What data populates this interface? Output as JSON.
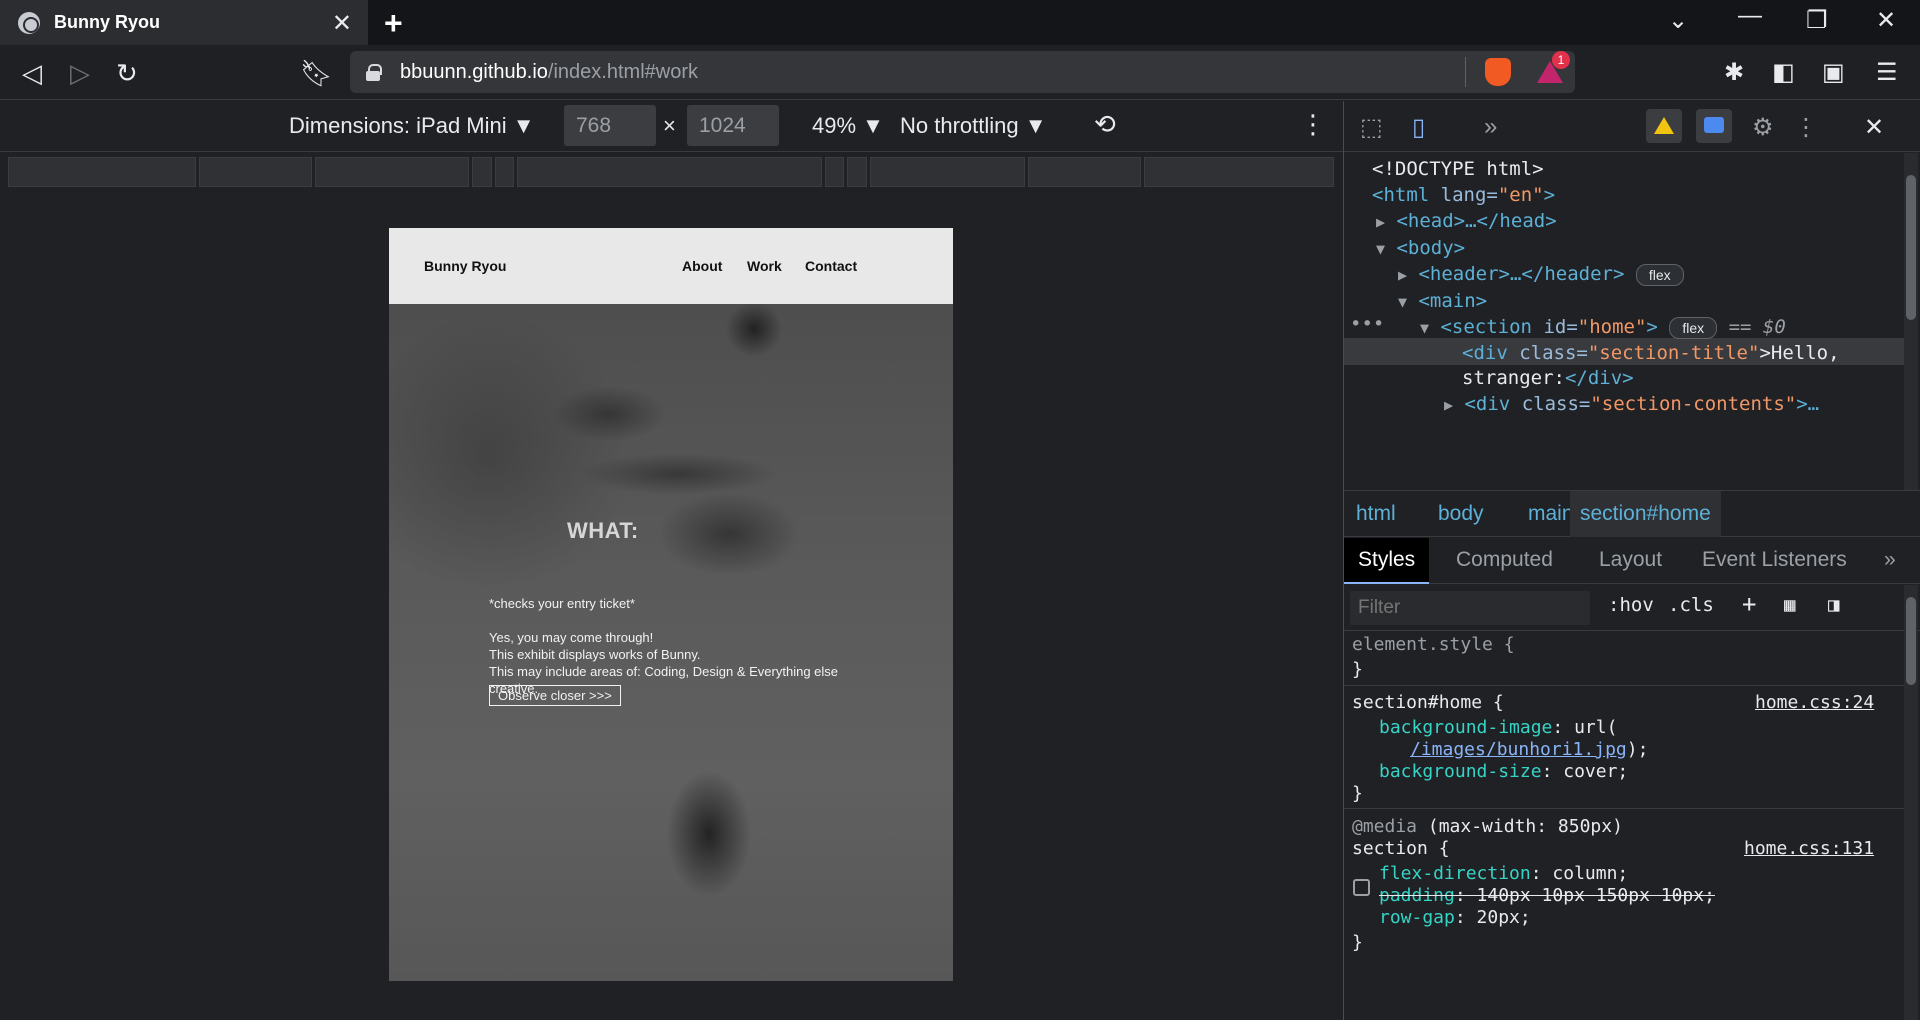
{
  "browser": {
    "tab_title": "Bunny Ryou",
    "url_host": "bbuunn.github.io",
    "url_path": "/index.html#work",
    "bat_badge": "1"
  },
  "device_toolbar": {
    "dimensions_label": "Dimensions: iPad Mini ▼",
    "width": "768",
    "height": "1024",
    "times": "×",
    "zoom": "49% ▼",
    "throttling": "No throttling ▼"
  },
  "site": {
    "brand": "Bunny Ryou",
    "nav": [
      "About",
      "Work",
      "Contact"
    ],
    "hero_title": "WHAT:",
    "line1": "*checks your entry ticket*",
    "line2": "Yes, you may come through!",
    "line3": "This exhibit displays works of Bunny.",
    "line4": "This may include areas of: Coding, Design & Everything else creative.",
    "button": "Observe closer >>>"
  },
  "devtools": {
    "elements": {
      "doctype": "<!DOCTYPE html>",
      "html_open": "<html",
      "html_attr": " lang=",
      "html_val": "\"en\"",
      "html_close": ">",
      "head": "<head>…</head>",
      "body": "<body>",
      "header": "<header>…</header>",
      "main": "<main>",
      "section_open": "<section",
      "section_attr": " id=",
      "section_val": "\"home\"",
      "section_close": ">",
      "flex": "flex",
      "eq0": "== $0",
      "div1_open": "<div",
      "div1_attr": " class=",
      "div1_val": "\"section-title\"",
      "div1_text": ">Hello,",
      "div1_text2": "stranger:",
      "div1_close": "</div>",
      "div2_val": "\"section-contents\"",
      "div2_rest": ">…",
      "dots": "•••"
    },
    "breadcrumbs": [
      "html",
      "body",
      "main",
      "section#home"
    ],
    "subtabs": [
      "Styles",
      "Computed",
      "Layout",
      "Event Listeners"
    ],
    "filter_placeholder": "Filter",
    "filter_hov": ":hov",
    "filter_cls": ".cls",
    "filter_add": "+",
    "styles": {
      "element_style": "element.style {",
      "close": "}",
      "rule1_selector": "section#home {",
      "rule1_source": "home.css:24",
      "rule1_prop1": "background-image",
      "rule1_val1": ": url(",
      "rule1_link": "/images/bunhori1.jpg",
      "rule1_val1b": ");",
      "rule1_prop2": "background-size",
      "rule1_val2": ": cover;",
      "media": "@media",
      "media_query": " (max-width: 850px)",
      "rule2_selector": "section {",
      "rule2_source": "home.css:131",
      "rule2_prop1": "flex-direction",
      "rule2_val1": ": column;",
      "rule2_prop2": "padding",
      "rule2_val2": ": 140px 10px 150px 10px;",
      "rule2_prop3": "row-gap",
      "rule2_val3": ": 20px;"
    }
  },
  "colors": {
    "accent": "#8ab4f8",
    "tag": "#5db0d7",
    "property": "#35d4c7",
    "warning": "#f3c312",
    "brave": "#f15a22"
  }
}
